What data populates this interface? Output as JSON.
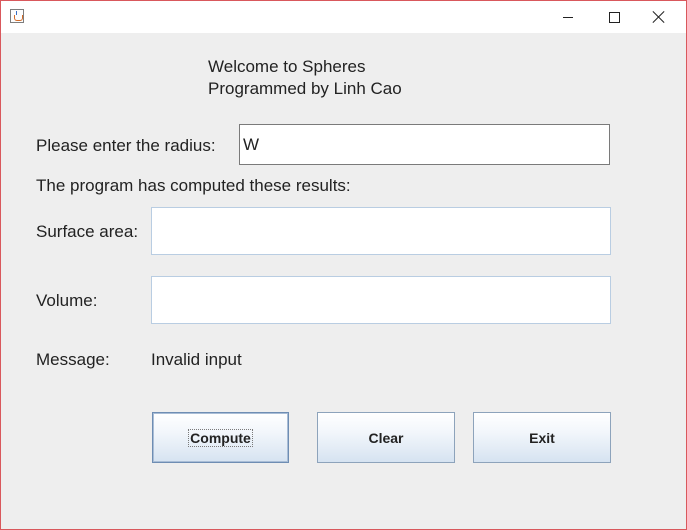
{
  "window": {
    "title": "",
    "controls": {
      "minimize": "minimize-icon",
      "maximize": "maximize-icon",
      "close": "close-icon"
    }
  },
  "header": {
    "welcome": "Welcome to Spheres",
    "author": "Programmed by Linh Cao"
  },
  "form": {
    "radius_label": "Please enter the radius:",
    "radius_value": "W",
    "results_caption": "The program has computed these results:",
    "surface_label": "Surface area:",
    "surface_value": "",
    "volume_label": "Volume:",
    "volume_value": "",
    "message_label": "Message:",
    "message_value": "Invalid input"
  },
  "buttons": {
    "compute": "Compute",
    "clear": "Clear",
    "exit": "Exit"
  },
  "colors": {
    "window_border": "#d9585c",
    "background": "#eeeeee",
    "field_border": "#b9cde2"
  }
}
